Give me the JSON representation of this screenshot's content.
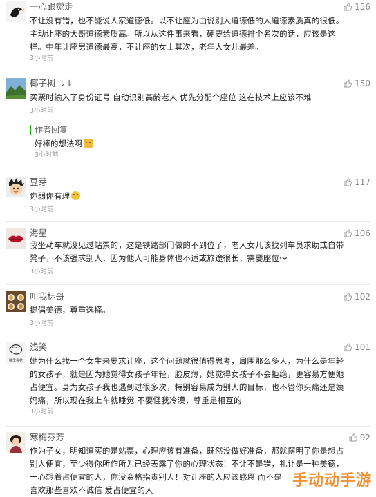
{
  "comments": [
    {
      "name": "一心跟觉走",
      "likes": "156",
      "lines": [
        "不让没有错，也不能说人家道德低。以不让座为由说别人道德低的人道德素质真的很低。",
        "主动让座的大哥道德素质高。所以从这件事来看，硬要给道德排个名次的话，应该是这",
        "样。中年让座男道德最高，不让座的女士其次，老年人女儿最差。"
      ],
      "time": "3小时前",
      "avatar": "black-bird-avatar"
    },
    {
      "name": "椰子树 ⇂⇂",
      "likes": "150",
      "lines": [
        "买票时输入了身份证号 自动识别高龄老人 优先分配个座位 这在技术上应该不难"
      ],
      "time": "3小时前",
      "avatar": "mountain-avatar",
      "reply": {
        "tag": "作者回复",
        "text": "好棒的想法啊",
        "time": "3小时前"
      }
    },
    {
      "name": "豆芽",
      "likes": "117",
      "lines": [
        "你弱你有理"
      ],
      "time": "3小时前",
      "avatar": "cartoon-avatar"
    },
    {
      "name": "海星",
      "likes": "106",
      "lines": [
        "我坐动车就没见过站票的，这是铁路部门做的不到位了，老人女儿该找列车员求助或自带",
        "凳子，不该强求别人，因为他人可能身体也不适或旅途很长，需要座位～"
      ],
      "time": "3小时前",
      "avatar": "red-lips-avatar"
    },
    {
      "name": "叫我标哥",
      "likes": "102",
      "lines": [
        "提倡美德，尊重选择。"
      ],
      "time": "3小时前",
      "avatar": "cups-avatar"
    },
    {
      "name": "浅笑",
      "likes": "101",
      "lines": [
        "她为什么找一个女生来要求让座，这个问题就很值得思考，周围那么多人，为什么是年轻",
        "的女孩子，就是因为她觉得女孩子年轻，脸皮薄，她觉得女孩子不会拒绝，更容易方便她",
        "占便宜。身为女孩子我也遇到过很多次，特别容易成为别人的目标，也不管你头痛还是姨",
        "妈痛，所以现在我上车就睡觉 不要怪我冷漠，尊重是相互的"
      ],
      "time": "3小时前",
      "avatar": "sketch-avatar",
      "avatar_text": "雾里看花"
    },
    {
      "name": "寒梅芬芳",
      "likes": "92",
      "lines": [
        "作为子女，明知道买的是站票，心理应该有准备，既然没做好准备，那就摆明了你是想占",
        "别人便宜，至少得你所作所为已经表露了你的心理状态！不让不是错，礼让是一种美德，",
        "一心想着占便宜的人，你没资格指责别人！对让座的人应该感恩 而不是",
        "喜欢那些喜欢不诚信 爱占便宜的人"
      ],
      "avatar": "lady-avatar"
    }
  ],
  "watermark": "手动动手游"
}
